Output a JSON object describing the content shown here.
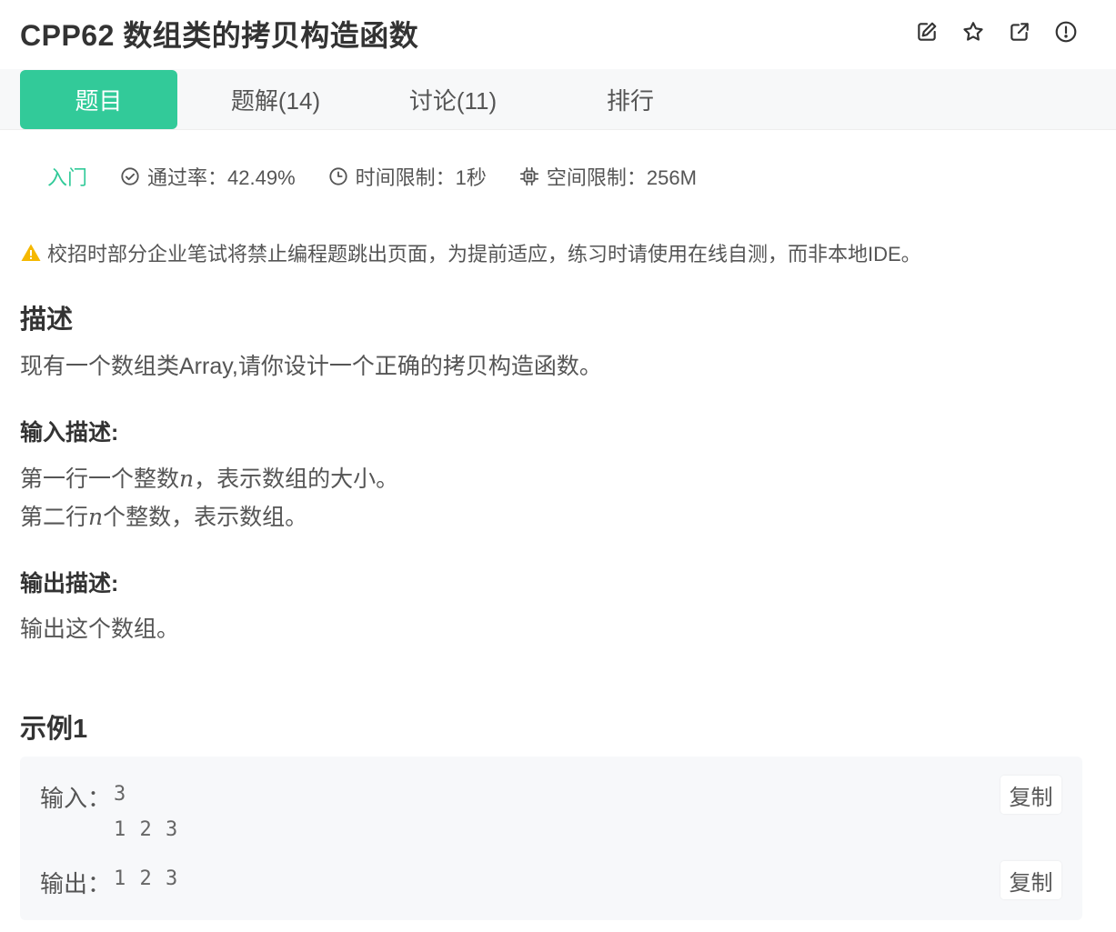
{
  "header": {
    "title": "CPP62  数组类的拷贝构造函数",
    "icons": [
      "edit-icon",
      "star-icon",
      "external-link-icon",
      "report-icon"
    ]
  },
  "tabs": [
    {
      "label": "题目",
      "active": true
    },
    {
      "label": "题解(14)",
      "active": false
    },
    {
      "label": "讨论(11)",
      "active": false
    },
    {
      "label": "排行",
      "active": false
    }
  ],
  "meta": {
    "level": "入门",
    "pass_rate": "通过率：42.49%",
    "time_limit": "时间限制：1秒",
    "memory_limit": "空间限制：256M"
  },
  "warning": "校招时部分企业笔试将禁止编程题跳出页面，为提前适应，练习时请使用在线自测，而非本地IDE。",
  "description": {
    "heading": "描述",
    "text": "现有一个数组类Array,请你设计一个正确的拷贝构造函数。"
  },
  "input_desc": {
    "heading": "输入描述:",
    "line1_prefix": "第一行一个整数",
    "line1_var": "n",
    "line1_suffix": "，表示数组的大小。",
    "line2_prefix": "第二行",
    "line2_var": "n",
    "line2_suffix": "个整数，表示数组。"
  },
  "output_desc": {
    "heading": "输出描述:",
    "text": "输出这个数组。"
  },
  "example": {
    "heading": "示例1",
    "input_label": "输入：",
    "input_line1": "3",
    "input_line2": "1 2 3",
    "output_label": "输出：",
    "output_value": "1 2 3",
    "copy_label": "复制"
  },
  "colors": {
    "accent": "#32ca99",
    "warning": "#f5b800"
  }
}
